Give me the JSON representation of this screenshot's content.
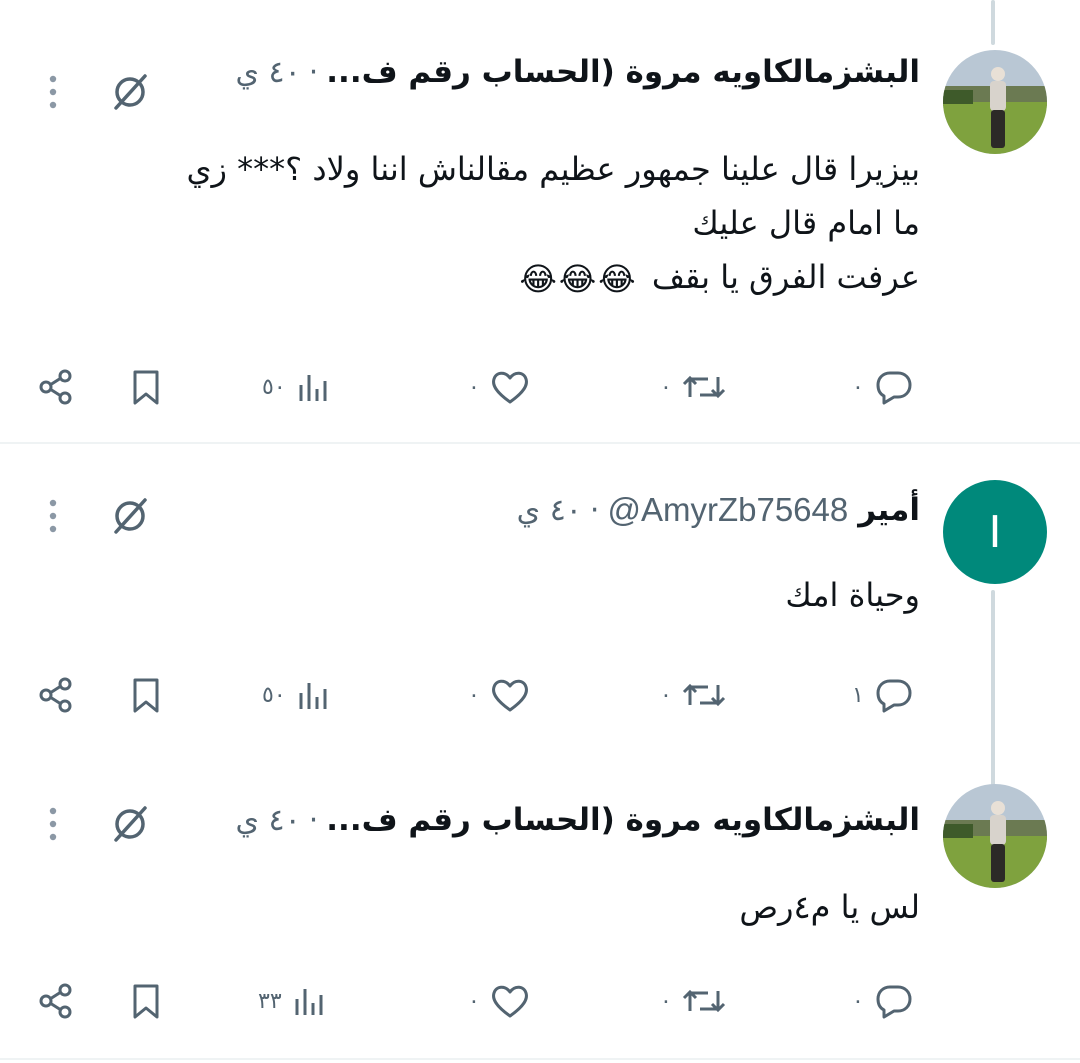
{
  "tweets": [
    {
      "author": "البشزمالكاويه مروة (الحساب رقم ف...",
      "handle": "",
      "time": "٤٠ ي",
      "lines": [
        "بيزيرا قال علينا جمهور عظيم مقالناش اننا ولاد ؟*** زي",
        "ما امام قال عليك",
        "عرفت الفرق يا بقف"
      ],
      "emojis": [
        "😂",
        "😂",
        "😂"
      ],
      "counts": {
        "replies": "٠",
        "retweets": "٠",
        "likes": "٠",
        "views": "٥٠"
      }
    },
    {
      "author": "أمير",
      "handle": "@AmyrZb75648",
      "time": "٤٠ ي",
      "avatar_letter": "I",
      "lines": [
        "وحياة امك"
      ],
      "counts": {
        "replies": "١",
        "retweets": "٠",
        "likes": "٠",
        "views": "٥٠"
      }
    },
    {
      "author": "البشزمالكاويه مروة (الحساب رقم ف...",
      "handle": "",
      "time": "٤٠ ي",
      "lines": [
        "لس يا م٤رص"
      ],
      "counts": {
        "replies": "٠",
        "retweets": "٠",
        "likes": "٠",
        "views": "٣٣"
      }
    }
  ],
  "colors": {
    "muted": "#536471",
    "avatar_teal": "#00897b",
    "thread_line": "#cfd9de",
    "divider": "#eff3f4"
  },
  "icons": [
    "reply-icon",
    "retweet-icon",
    "like-icon",
    "views-icon",
    "bookmark-icon",
    "share-icon",
    "grok-icon",
    "more-icon"
  ]
}
